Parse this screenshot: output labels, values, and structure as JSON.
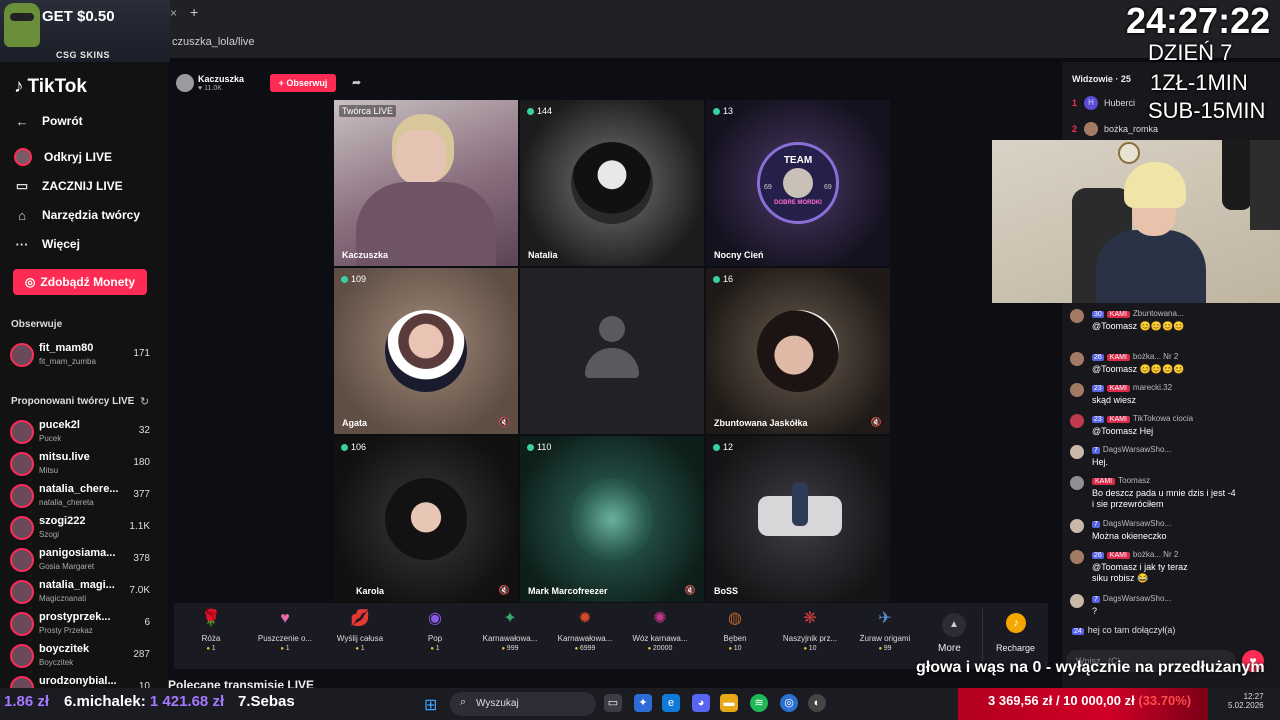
{
  "browser": {
    "url": "czuszka_lola/live",
    "tab_close": "×",
    "new_tab": "+"
  },
  "ad": {
    "text": "GET $0.50",
    "brand": "CSG SKINS"
  },
  "sidebar": {
    "logo": "TikTok",
    "nav": [
      {
        "label": "Powrót",
        "icon": "arrow-left-icon",
        "glyph": "←"
      },
      {
        "label": "Odkryj LIVE",
        "icon": "avatar-icon",
        "glyph": "●"
      },
      {
        "label": "ZACZNIJ LIVE",
        "icon": "camera-icon",
        "glyph": "▭"
      },
      {
        "label": "Narzędzia twórcy",
        "icon": "home-icon",
        "glyph": "⌂"
      },
      {
        "label": "Więcej",
        "icon": "more-icon",
        "glyph": "···"
      }
    ],
    "coins_button": "Zdobądź Monety",
    "following_title": "Obserwuje",
    "following": [
      {
        "name": "fit_mam80",
        "sub": "fit_mam_zumba",
        "count": "171"
      }
    ],
    "suggested_title": "Proponowani twórcy LIVE",
    "suggested": [
      {
        "name": "pucek2l",
        "sub": "Pucek",
        "count": "32"
      },
      {
        "name": "mitsu.live",
        "sub": "Mitsu",
        "count": "180"
      },
      {
        "name": "natalia_chere...",
        "sub": "natalia_chereta",
        "count": "377"
      },
      {
        "name": "szogi222",
        "sub": "Szogi",
        "count": "1.1K"
      },
      {
        "name": "panigosiama...",
        "sub": "Gosia Margaret",
        "count": "378"
      },
      {
        "name": "natalia_magi...",
        "sub": "Magicznanati",
        "count": "7.0K"
      },
      {
        "name": "prostyprzek...",
        "sub": "Prosty Przekaz",
        "count": "6"
      },
      {
        "name": "boyczitek",
        "sub": "Boyczitek",
        "count": "287"
      },
      {
        "name": "urodzonybial...",
        "sub": "",
        "count": "10"
      }
    ]
  },
  "host": {
    "name": "Kaczuszka",
    "likes": "11.0K",
    "follow": "+ Obserwuj"
  },
  "grid": [
    {
      "tag": "Twórca LIVE",
      "count": "",
      "name": "Kaczuszka"
    },
    {
      "tag": "",
      "count": "144",
      "name": "Natalia"
    },
    {
      "tag": "",
      "count": "13",
      "name": "Nocny Cień"
    },
    {
      "tag": "",
      "count": "109",
      "name": "Agata"
    },
    {
      "tag": "",
      "count": "",
      "name": ""
    },
    {
      "tag": "",
      "count": "16",
      "name": "Zbuntowana Jaskółka"
    },
    {
      "tag": "",
      "count": "106",
      "name": "Karola"
    },
    {
      "tag": "",
      "count": "110",
      "name": "Mark Marcofreezer"
    },
    {
      "tag": "",
      "count": "12",
      "name": "BoSS"
    }
  ],
  "team_badge": {
    "top": "TEAM",
    "bottom": "DOBRE MORDKI",
    "num_l": "69",
    "num_r": "69"
  },
  "gifts": [
    {
      "name": "Róża",
      "price": "1",
      "glyph": "🌹",
      "color": "#c21f3a"
    },
    {
      "name": "Puszczenie o...",
      "price": "1",
      "glyph": "♥",
      "color": "#e66aa8"
    },
    {
      "name": "Wyślij całusa",
      "price": "1",
      "glyph": "💋",
      "color": "#d0263c"
    },
    {
      "name": "Pop",
      "price": "1",
      "glyph": "◉",
      "color": "#6a3bd6"
    },
    {
      "name": "Karnawałowa...",
      "price": "999",
      "glyph": "✦",
      "color": "#3aa86b"
    },
    {
      "name": "Karnawałowa...",
      "price": "6999",
      "glyph": "✹",
      "color": "#d5472a"
    },
    {
      "name": "Wóz karnawa...",
      "price": "20000",
      "glyph": "✺",
      "color": "#c2358a"
    },
    {
      "name": "Bęben",
      "price": "10",
      "glyph": "◍",
      "color": "#b8642a"
    },
    {
      "name": "Naszyjnik prz...",
      "price": "10",
      "glyph": "❋",
      "color": "#c93b3b"
    },
    {
      "name": "Żuraw origami",
      "price": "99",
      "glyph": "✈",
      "color": "#5c8ed6"
    }
  ],
  "gift_more": "More",
  "recharge": "Recharge",
  "recommended_title": "Polecane transmisje LIVE",
  "viewers": {
    "title": "Widzowie",
    "count": "25",
    "list": [
      {
        "rank": "1",
        "initial": "H",
        "name": "Huberci"
      },
      {
        "rank": "2",
        "initial": "",
        "name": "bożka_romka"
      }
    ]
  },
  "chat": [
    {
      "lvl": "30",
      "fan": "KAMI",
      "user": "Zbuntowana...",
      "text": "@Toomasz 😊😊😊😊"
    },
    {
      "lvl": "26",
      "fan": "KAMI",
      "user": "bożka... Nr 2",
      "text": "@Toomasz 😊😊😊😊"
    },
    {
      "lvl": "23",
      "fan": "KAMI",
      "user": "marecki.32",
      "text": "skąd wiesz"
    },
    {
      "lvl": "23",
      "fan": "KAMI",
      "user": "TikTokowa ciocia",
      "text": "@Toomasz Hej"
    },
    {
      "lvl": "7",
      "fan": "",
      "user": "DagsWarsawSho...",
      "text": "Hej."
    },
    {
      "lvl": "",
      "fan": "KAMI",
      "user": "Toomasz",
      "text": "Bo deszcz pada u mnie dzis i jest -4"
    },
    {
      "lvl": "7",
      "fan": "",
      "user": "DagsWarsawSho...",
      "text": "Można okieneczko"
    },
    {
      "lvl": "26",
      "fan": "KAMI",
      "user": "bożka... Nr 2",
      "text": "@Toomasz i jak ty teraz"
    },
    {
      "lvl": "7",
      "fan": "",
      "user": "DagsWarsawSho...",
      "text": "?"
    }
  ],
  "chat_extra": {
    "line2": "i sie przewróciłem",
    "line3": "siku robisz 😂"
  },
  "joined": {
    "lvl": "24",
    "text": "hej co tam",
    "suffix": "dołączył(a)"
  },
  "chat_input_placeholder": "Wpisz...(C)",
  "overlay": {
    "timer": "24:27:22",
    "day": "DZIEŃ 7",
    "rate1": "1ZŁ-1MIN",
    "rate2": "SUB-15MIN",
    "marquee": "głowa i wąs na 0 - wyłącznie na przedłużanym"
  },
  "bottom": {
    "left_amount": "1.86 zł",
    "donor2_name": "6.michalek:",
    "donor2_amount": "1 421.68 zł",
    "donor3": "7.Sebas",
    "search": "Wyszukaj",
    "goal_current": "3 369,56 zł",
    "goal_target": "10 000,00 zł",
    "goal_pct": "(33.70%)",
    "time": "12:27",
    "date": "5.02.2026"
  }
}
